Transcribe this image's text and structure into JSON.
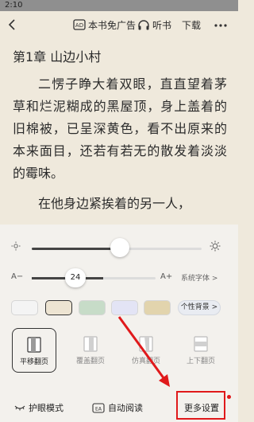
{
  "status": {
    "time": "2:10"
  },
  "toolbar": {
    "ad_free_label": "本书免广告",
    "listen_label": "听书",
    "download_label": "下载"
  },
  "chapter": {
    "title": "第1章 山边小村",
    "paragraphs": [
      "二愣子睁大着双眼，直直望着茅草和烂泥糊成的黑屋顶，身上盖着的旧棉被，已呈深黄色，看不出原来的本来面目，还若有若无的散发着淡淡的霉味。",
      "在他身边紧挨着的另一人，"
    ]
  },
  "settings": {
    "brightness": 0.52,
    "font": {
      "minus_label": "A−",
      "plus_label": "A+",
      "size": "24",
      "system_font_label": "系统字体 >"
    },
    "backgrounds": [
      {
        "color": "#f4f4f4",
        "selected": false
      },
      {
        "color": "#ede4d2",
        "selected": true
      },
      {
        "color": "#c7dcc8",
        "selected": false
      },
      {
        "color": "#e3e4f5",
        "selected": false
      },
      {
        "color": "#e2d4ad",
        "selected": false
      }
    ],
    "custom_background_label": "个性背景 >",
    "flip_modes": [
      {
        "label": "平移翻页",
        "icon": "slide-page-icon",
        "active": true
      },
      {
        "label": "覆盖翻页",
        "icon": "cover-page-icon",
        "active": false
      },
      {
        "label": "仿真翻页",
        "icon": "curl-page-icon",
        "active": false
      },
      {
        "label": "上下翻页",
        "icon": "scroll-page-icon",
        "active": false
      }
    ],
    "bottom": {
      "eye_mode_label": "护眼模式",
      "auto_read_label": "自动阅读",
      "auto_read_icon_text": "EA",
      "more_settings_label": "更多设置"
    }
  },
  "accent_color": "#e0191b"
}
